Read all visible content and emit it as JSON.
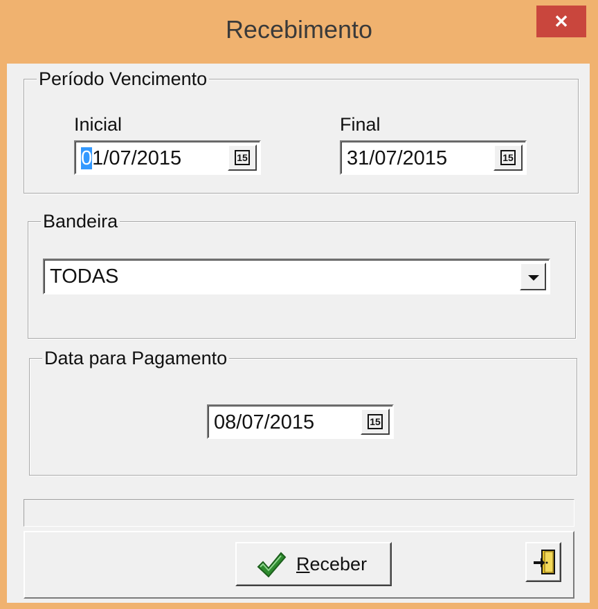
{
  "window": {
    "title": "Recebimento",
    "close_glyph": "✕"
  },
  "periodo": {
    "legend": "Período Vencimento",
    "inicial_label": "Inicial",
    "inicial_value_sel": "0",
    "inicial_value_rest": "1/07/2015",
    "final_label": "Final",
    "final_value": "31/07/2015"
  },
  "bandeira": {
    "legend": "Bandeira",
    "selected": "TODAS"
  },
  "pagamento": {
    "legend": "Data para Pagamento",
    "value": "08/07/2015"
  },
  "calendar_icon_text": "15",
  "buttons": {
    "receber_accel": "R",
    "receber_rest": "eceber"
  },
  "icons": {
    "calendar": "calendar-icon",
    "dropdown": "chevron-down-icon",
    "confirm": "checkmark-icon",
    "exit": "exit-door-icon"
  },
  "colors": {
    "titlebar": "#f0b26f",
    "close": "#c9463d",
    "selection": "#3399ff",
    "check_green": "#2e8b2e"
  }
}
